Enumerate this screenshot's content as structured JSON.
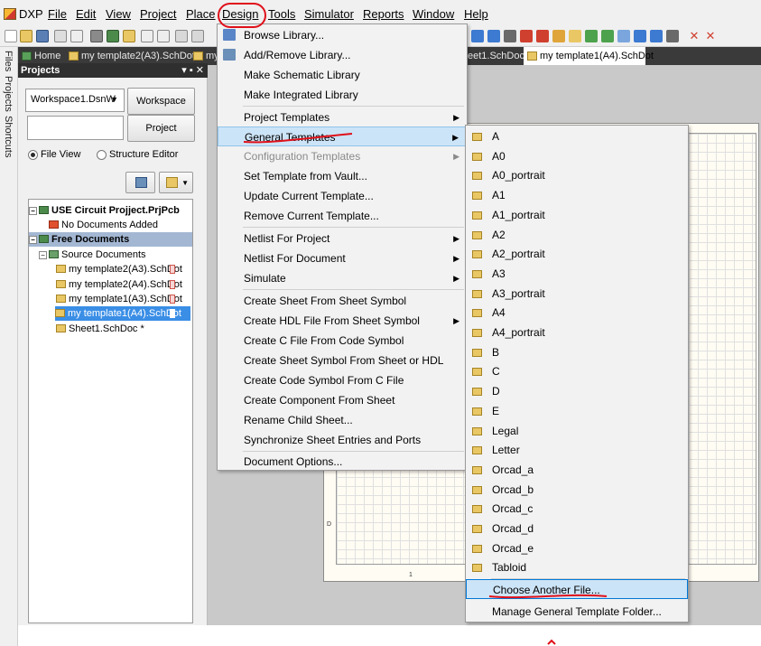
{
  "menubar": {
    "items": [
      "DXP",
      "File",
      "Edit",
      "View",
      "Project",
      "Place",
      "Design",
      "Tools",
      "Simulator",
      "Reports",
      "Window",
      "Help"
    ]
  },
  "tabs": [
    {
      "label": "Home"
    },
    {
      "label": "my template2(A3).SchDot *"
    },
    {
      "label": "my"
    },
    {
      "label": "eet1.SchDoc *"
    },
    {
      "label": "my template1(A4).SchDot"
    }
  ],
  "left_strip": [
    "Files",
    "Projects",
    "Shortcuts"
  ],
  "panel": {
    "title": "Projects",
    "pin": "▾ ▪ ✕",
    "workspace_value": "Workspace1.DsnW",
    "workspace_button": "Workspace",
    "project_button": "Project",
    "file_view": "File View",
    "structure_editor": "Structure Editor",
    "tree": {
      "project": "USE Circuit Projject.PrjPcb",
      "no_docs": "No Documents Added",
      "free_docs": "Free Documents",
      "source_docs": "Source Documents",
      "files": [
        "my template2(A3).SchDot",
        "my template2(A4).SchDot",
        "my template1(A3).SchDot",
        "my template1(A4).SchDot",
        "Sheet1.SchDoc *"
      ]
    }
  },
  "design_menu": {
    "items": [
      {
        "label": "Browse Library...",
        "u": "B"
      },
      {
        "label": "Add/Remove Library...",
        "u": "L"
      },
      {
        "label": "Make Schematic Library",
        "u": "M"
      },
      {
        "label": "Make Integrated Library",
        "u": "a"
      },
      {
        "label": "Project Templates",
        "u": "P"
      },
      {
        "label": "General Templates",
        "u": "G"
      },
      {
        "label": "Configuration Templates",
        "u": "C"
      },
      {
        "label": "Set Template from Vault...",
        "u": "S"
      },
      {
        "label": "Update Current Template...",
        "u": "d"
      },
      {
        "label": "Remove Current Template...",
        "u": "v"
      },
      {
        "label": "Netlist For Project",
        "u": "N"
      },
      {
        "label": "Netlist For Document",
        "u": "e"
      },
      {
        "label": "Simulate",
        "u": "S"
      },
      {
        "label": "Create Sheet From Sheet Symbol",
        "u": "r"
      },
      {
        "label": "Create HDL File From Sheet Symbol",
        "u": "H"
      },
      {
        "label": "Create C File From Code Symbol",
        "u": "F"
      },
      {
        "label": "Create Sheet Symbol From Sheet or HDL",
        "u": "y"
      },
      {
        "label": "Create Code Symbol From C File",
        "u": "o"
      },
      {
        "label": "Create Component From Sheet",
        "u": "t"
      },
      {
        "label": "Rename Child Sheet...",
        "u": "C"
      },
      {
        "label": "Synchronize Sheet Entries and Ports",
        "u": "P"
      },
      {
        "label": "Document Options...",
        "u": "O"
      }
    ]
  },
  "general_templates": {
    "items": [
      "A",
      "A0",
      "A0_portrait",
      "A1",
      "A1_portrait",
      "A2",
      "A2_portrait",
      "A3",
      "A3_portrait",
      "A4",
      "A4_portrait",
      "B",
      "C",
      "D",
      "E",
      "Legal",
      "Letter",
      "Orcad_a",
      "Orcad_b",
      "Orcad_c",
      "Orcad_d",
      "Orcad_e",
      "Tabloid"
    ],
    "choose_another": "Choose Another File...",
    "manage": "Manage General Template Folder..."
  },
  "sheet_marks": {
    "left": "D",
    "bottom": "1"
  },
  "colors": {
    "annotation": "#e0101a",
    "highlight": "#cce4f7",
    "accent": "#0078d7"
  }
}
